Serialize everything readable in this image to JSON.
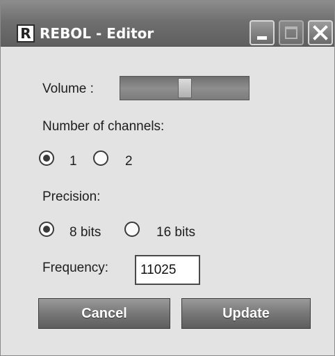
{
  "window": {
    "title": "REBOL - Editor",
    "logo_letter": "R"
  },
  "titlebar_buttons": {
    "minimize": "minimize-icon",
    "maximize": "maximize-icon",
    "close": "close-icon"
  },
  "volume": {
    "label": "Volume :",
    "level": 0.5
  },
  "channels": {
    "label": "Number of channels:",
    "options": [
      "1",
      "2"
    ],
    "selected": "1"
  },
  "precision": {
    "label": "Precision:",
    "options": [
      "8 bits",
      "16 bits"
    ],
    "selected": "8 bits"
  },
  "frequency": {
    "label": "Frequency:",
    "value": "11025"
  },
  "buttons": {
    "cancel": "Cancel",
    "update": "Update"
  }
}
